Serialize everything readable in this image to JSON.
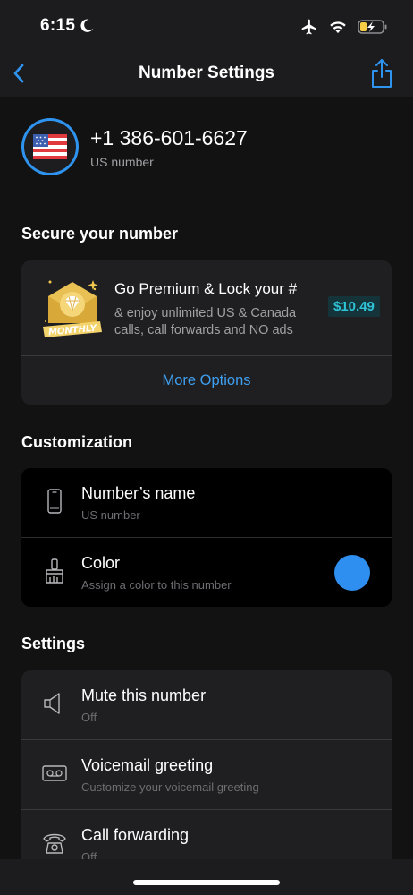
{
  "status_bar": {
    "time": "6:15",
    "icons": [
      "moon-icon",
      "airplane-icon",
      "wifi-icon",
      "battery-charging-icon"
    ]
  },
  "nav": {
    "title": "Number Settings",
    "back_icon": "chevron-left-icon",
    "share_icon": "share-icon",
    "accent_color": "#2f94f0"
  },
  "number": {
    "value": "+1 386-601-6627",
    "label": "US number",
    "flag_icon": "us-flag-icon"
  },
  "sections": {
    "secure": {
      "title": "Secure your number",
      "premium": {
        "badge_text": "MONTHLY",
        "title": "Go Premium & Lock your #",
        "description": "& enjoy unlimited US & Canada calls, call forwards and NO ads",
        "price": "$10.49",
        "price_color": "#2fc3d6"
      },
      "more_options": "More Options"
    },
    "customization": {
      "title": "Customization",
      "items": [
        {
          "title": "Number’s name",
          "subtitle": "US number",
          "icon": "phone-device-icon"
        },
        {
          "title": "Color",
          "subtitle": "Assign a color to this number",
          "icon": "paintbrush-icon",
          "color": "#2f8ff0"
        }
      ]
    },
    "settings": {
      "title": "Settings",
      "items": [
        {
          "title": "Mute this number",
          "subtitle": "Off",
          "icon": "speaker-icon"
        },
        {
          "title": "Voicemail greeting",
          "subtitle": "Customize your voicemail greeting",
          "icon": "voicemail-icon"
        },
        {
          "title": "Call forwarding",
          "subtitle": "Off",
          "icon": "telephone-icon"
        }
      ]
    }
  }
}
